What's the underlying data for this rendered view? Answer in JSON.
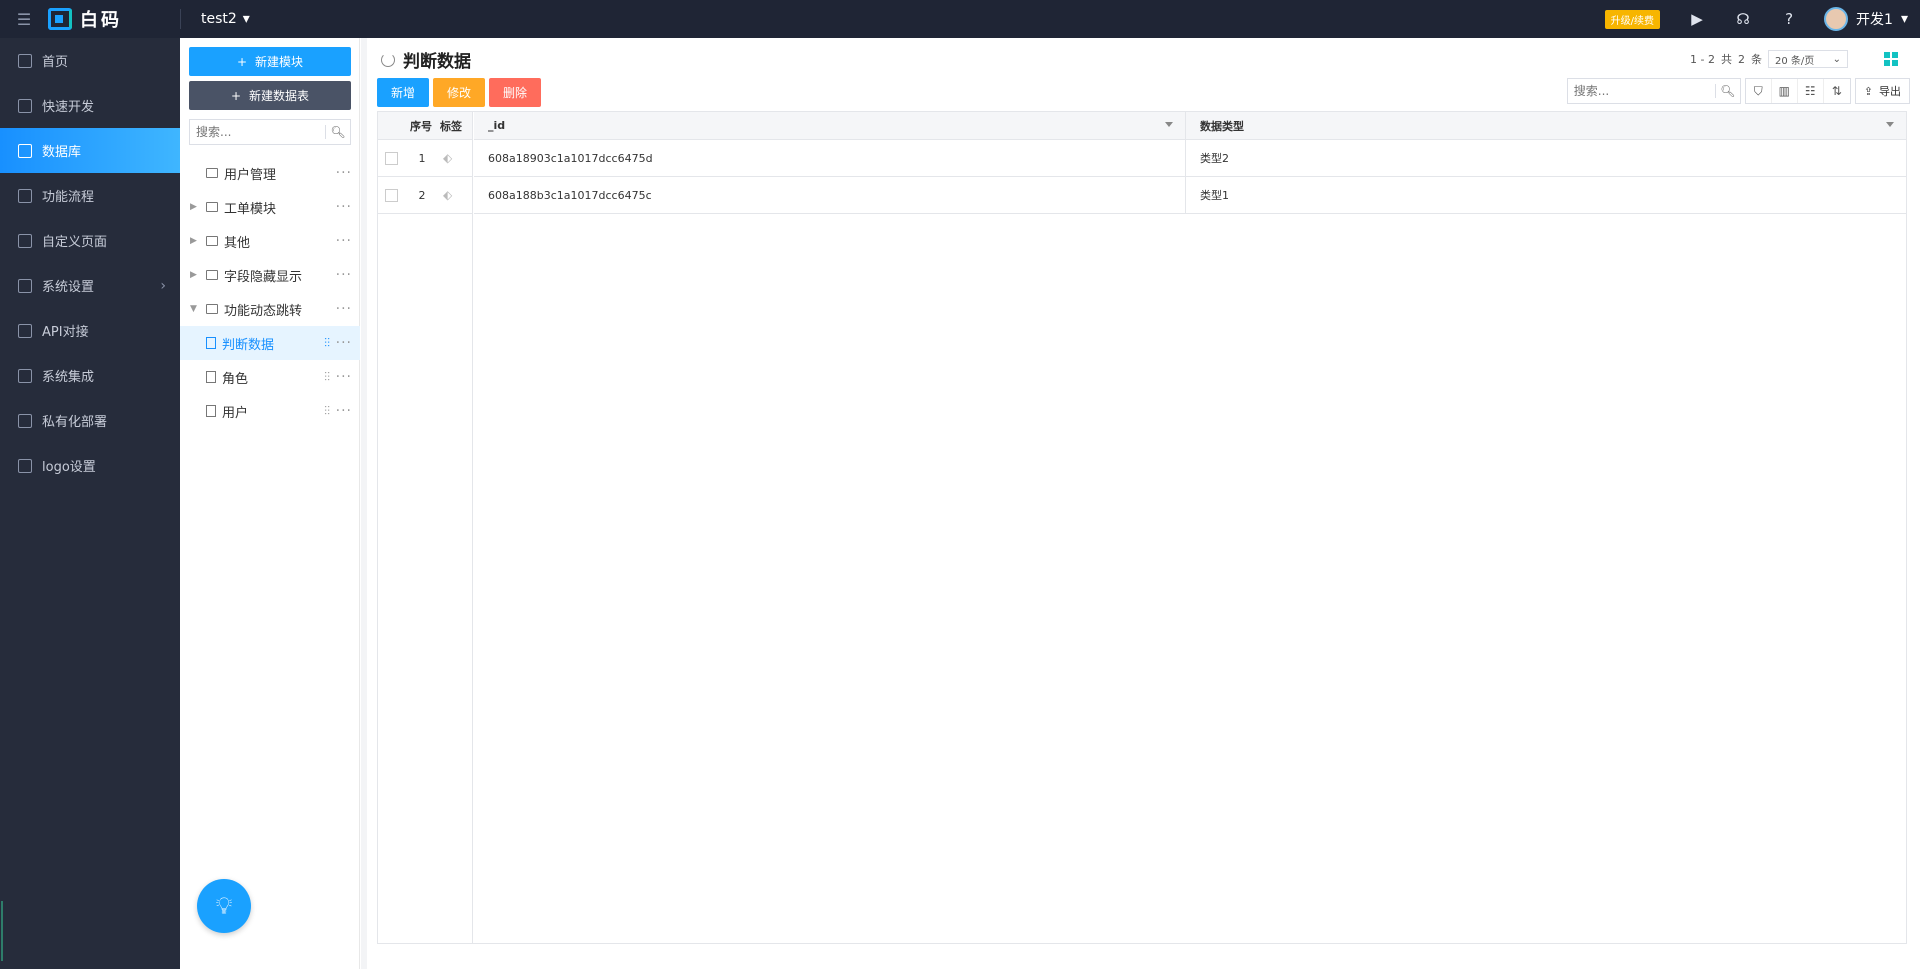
{
  "topbar": {
    "brand_name": "白码",
    "app_name": "test2",
    "upgrade_label": "升级/续费",
    "user_name": "开发1"
  },
  "nav": {
    "items": [
      {
        "label": "首页",
        "icon": "home-icon"
      },
      {
        "label": "快速开发",
        "icon": "cube-icon"
      },
      {
        "label": "数据库",
        "icon": "database-icon",
        "active": true
      },
      {
        "label": "功能流程",
        "icon": "flow-icon"
      },
      {
        "label": "自定义页面",
        "icon": "page-icon"
      },
      {
        "label": "系统设置",
        "icon": "settings-icon",
        "has_arrow": true
      },
      {
        "label": "API对接",
        "icon": "api-icon"
      },
      {
        "label": "系统集成",
        "icon": "layers-icon"
      },
      {
        "label": "私有化部署",
        "icon": "lock-icon"
      },
      {
        "label": "logo设置",
        "icon": "logo-icon"
      }
    ]
  },
  "tree_panel": {
    "new_module_label": "新建模块",
    "new_table_label": "新建数据表",
    "search_placeholder": "搜索...",
    "items": [
      {
        "label": "用户管理",
        "type": "folder",
        "expandable": false
      },
      {
        "label": "工单模块",
        "type": "folder",
        "expandable": true
      },
      {
        "label": "其他",
        "type": "folder",
        "expandable": true
      },
      {
        "label": "字段隐藏显示",
        "type": "folder",
        "expandable": true
      },
      {
        "label": "功能动态跳转",
        "type": "folder",
        "expanded": true
      },
      {
        "label": "判断数据",
        "type": "table",
        "selected": true
      },
      {
        "label": "角色",
        "type": "table"
      },
      {
        "label": "用户",
        "type": "table"
      }
    ]
  },
  "main": {
    "title": "判断数据",
    "pager": {
      "range": "1 - 2",
      "total_prefix": "共",
      "total": "2",
      "total_suffix": "条",
      "page_size": "20 条/页"
    },
    "actions": {
      "add": "新增",
      "edit": "修改",
      "delete": "删除"
    },
    "search_placeholder": "搜索...",
    "export_label": "导出",
    "table": {
      "fixed_headers": {
        "seq": "序号",
        "tag": "标签"
      },
      "columns": [
        "_id",
        "数据类型"
      ],
      "rows": [
        {
          "seq": "1",
          "id": "608a18903c1a1017dcc6475d",
          "type": "类型2"
        },
        {
          "seq": "2",
          "id": "608a188b3c1a1017dcc6475c",
          "type": "类型1"
        }
      ]
    }
  }
}
